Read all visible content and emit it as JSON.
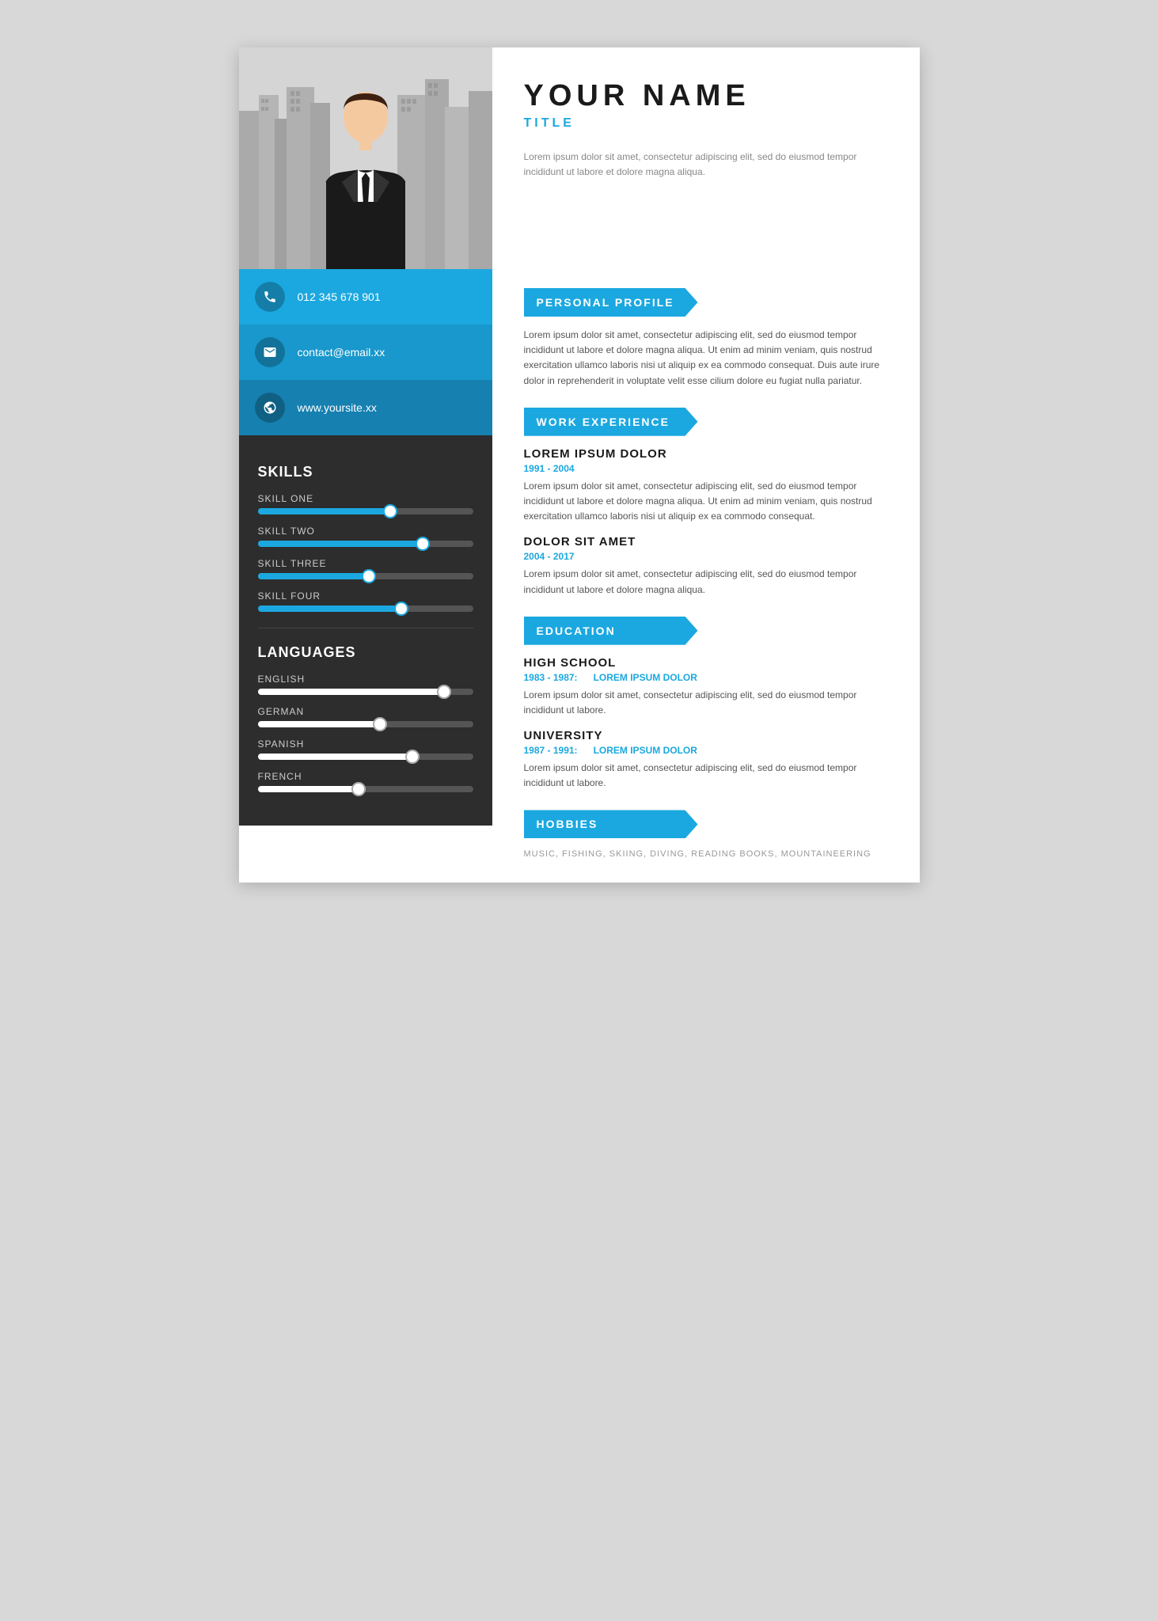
{
  "person": {
    "name": "YOUR NAME",
    "title": "TITLE",
    "summary": "Lorem ipsum dolor sit amet, consectetur adipiscing elit, sed do eiusmod tempor incididunt ut labore et dolore magna aliqua."
  },
  "contact": {
    "phone": "012 345 678 901",
    "email": "contact@email.xx",
    "website": "www.yoursite.xx"
  },
  "skills": {
    "title": "SKILLS",
    "items": [
      {
        "label": "SKILL ONE",
        "percent": 65
      },
      {
        "label": "SKILL TWO",
        "percent": 80
      },
      {
        "label": "SKILL THREE",
        "percent": 55
      },
      {
        "label": "SKILL FOUR",
        "percent": 70
      }
    ]
  },
  "languages": {
    "title": "LANGUAGES",
    "items": [
      {
        "label": "ENGLISH",
        "percent": 90
      },
      {
        "label": "GERMAN",
        "percent": 60
      },
      {
        "label": "SPANISH",
        "percent": 75
      },
      {
        "label": "FRENCH",
        "percent": 50
      }
    ]
  },
  "sections": {
    "personal_profile": {
      "title": "PERSONAL PROFILE",
      "text": "Lorem ipsum dolor sit amet, consectetur adipiscing elit, sed do eiusmod tempor incididunt ut labore et dolore magna aliqua. Ut enim ad minim veniam, quis nostrud exercitation ullamco laboris nisi ut aliquip ex ea commodo consequat. Duis aute irure dolor in reprehenderit in voluptate velit esse cilium dolore eu fugiat nulla pariatur."
    },
    "work_experience": {
      "title": "WORK EXPERIENCE",
      "jobs": [
        {
          "title": "LOREM IPSUM DOLOR",
          "date": "1991 - 2004",
          "desc": "Lorem ipsum dolor sit amet, consectetur adipiscing elit, sed do eiusmod tempor incididunt ut labore et dolore magna aliqua. Ut enim ad minim veniam, quis nostrud exercitation ullamco laboris nisi ut aliquip ex ea commodo consequat."
        },
        {
          "title": "DOLOR SIT AMET",
          "date": "2004 - 2017",
          "desc": "Lorem ipsum dolor sit amet, consectetur adipiscing elit, sed do eiusmod tempor incididunt ut labore et dolore magna aliqua."
        }
      ]
    },
    "education": {
      "title": "EDUCATION",
      "entries": [
        {
          "degree": "HIGH SCHOOL",
          "date": "1983 - 1987:",
          "school": "LOREM IPSUM DOLOR",
          "desc": "Lorem ipsum dolor sit amet, consectetur adipiscing elit, sed do eiusmod tempor incididunt ut labore."
        },
        {
          "degree": "UNIVERSITY",
          "date": "1987 - 1991:",
          "school": "LOREM IPSUM DOLOR",
          "desc": "Lorem ipsum dolor sit amet, consectetur adipiscing elit, sed do eiusmod tempor incididunt ut labore."
        }
      ]
    },
    "hobbies": {
      "title": "HOBBIES",
      "text": "MUSIC, FISHING, SKIING, DIVING, READING BOOKS, MOUNTAINEERING"
    }
  }
}
